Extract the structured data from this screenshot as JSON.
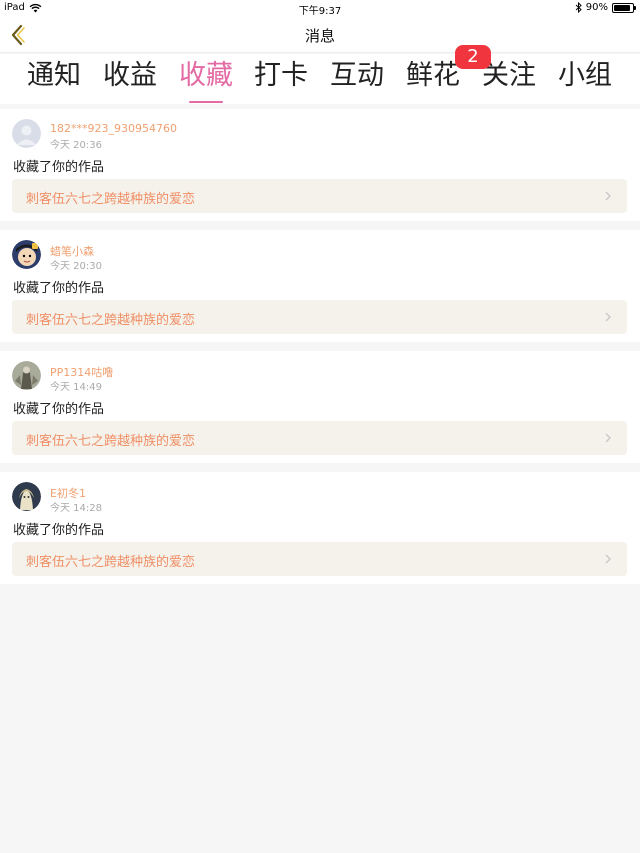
{
  "status_bar": {
    "device": "iPad",
    "time": "下午9:37",
    "battery_text": "90%",
    "battery_level": 0.9
  },
  "nav": {
    "title": "消息"
  },
  "tabs": [
    {
      "label": "通知"
    },
    {
      "label": "收益"
    },
    {
      "label": "收藏"
    },
    {
      "label": "打卡"
    },
    {
      "label": "互动"
    },
    {
      "label": "鲜花"
    },
    {
      "label": "关注"
    },
    {
      "label": "小组"
    }
  ],
  "active_tab": "收藏",
  "badge": {
    "count": "2",
    "tab": "关注"
  },
  "colors": {
    "accent": "#e46aa4",
    "username": "#f0a070",
    "work_title": "#f08f67",
    "badge": "#f0353f",
    "link_bg": "#f4f2ea"
  },
  "items": [
    {
      "username": "182***923_930954760",
      "time": "今天 20:36",
      "action": "收藏了你的作品",
      "work": "刺客伍六七之跨越种族的爱恋",
      "avatar": "default-avatar"
    },
    {
      "username": "蜡笔小森",
      "time": "今天 20:30",
      "action": "收藏了你的作品",
      "work": "刺客伍六七之跨越种族的爱恋",
      "avatar": "cartoon-avatar"
    },
    {
      "username": "PP1314咕噜",
      "time": "今天 14:49",
      "action": "收藏了你的作品",
      "work": "刺客伍六七之跨越种族的爱恋",
      "avatar": "photo-avatar"
    },
    {
      "username": "E初冬1",
      "time": "今天 14:28",
      "action": "收藏了你的作品",
      "work": "刺客伍六七之跨越种族的爱恋",
      "avatar": "anime-avatar"
    }
  ]
}
